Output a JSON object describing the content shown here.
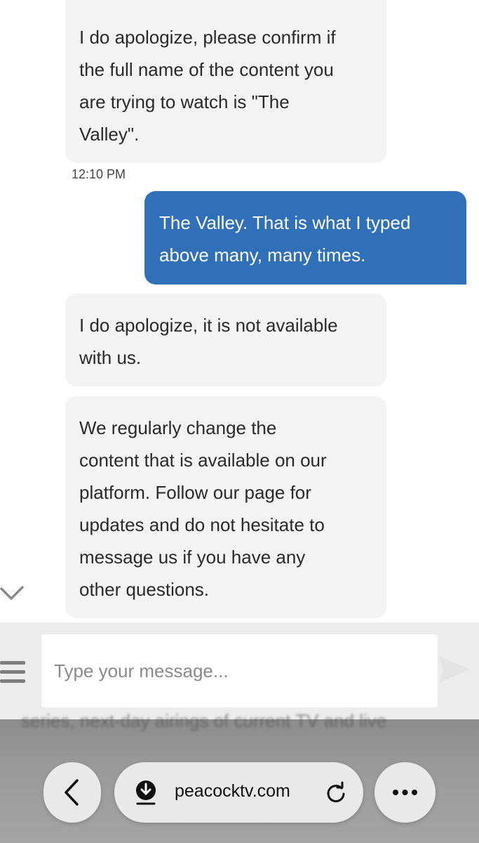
{
  "messages": [
    {
      "sender": "agent",
      "text": "I do apologize, please confirm if\nthe full name of the content you\nare trying to watch is \"The\nValley\"."
    },
    {
      "sender": "user",
      "text": "The Valley. That is what I typed\nabove many, many times."
    },
    {
      "sender": "agent",
      "text": "I do apologize, it is not available\nwith us."
    },
    {
      "sender": "agent",
      "text": "We regularly change the\ncontent that is available on our\nplatform. Follow our page for\nupdates and do not hesitate to\nmessage us if you have any\nother questions."
    }
  ],
  "timestamp": "12:10 PM",
  "composer": {
    "placeholder": "Type your message..."
  },
  "background_text": "series, next-day airings of current TV and live",
  "browser": {
    "url": "peacocktv.com"
  },
  "colors": {
    "user_bubble": "#2f70b8",
    "agent_bubble": "#f3f3f3"
  },
  "icons": [
    "chevron-down-icon",
    "menu-icon",
    "send-icon",
    "back-chevron-icon",
    "download-icon",
    "reload-icon",
    "more-icon"
  ]
}
